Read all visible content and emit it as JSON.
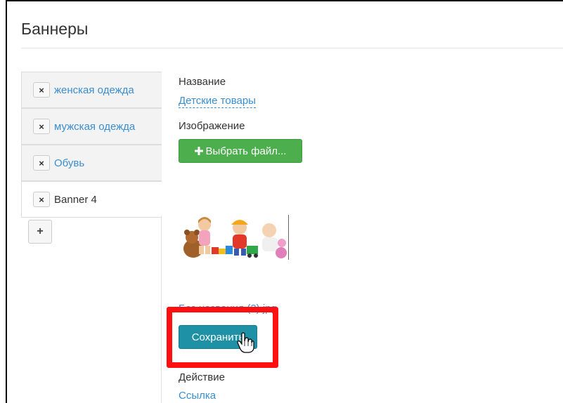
{
  "page": {
    "title": "Баннеры"
  },
  "sidebar": {
    "items": [
      {
        "label": "женская одежда",
        "remove": "×",
        "active": false
      },
      {
        "label": "мужская одежда",
        "remove": "×",
        "active": false
      },
      {
        "label": "Обувь",
        "remove": "×",
        "active": false
      },
      {
        "label": "Banner 4",
        "remove": "×",
        "active": true
      }
    ],
    "add_label": "+"
  },
  "form": {
    "name_label": "Название",
    "name_value": "Детские товары",
    "image_label": "Изображение",
    "choose_file_icon": "plus-icon",
    "choose_file_label": "Выбрать файл...",
    "file_name": "Без названия (2).jpg",
    "save_label": "Сохранить",
    "action_label": "Действие",
    "action_value": "Ссылка"
  },
  "colors": {
    "link": "#3a8ed0",
    "choose_button": "#4cae4c",
    "save_button": "#1f91a6",
    "highlight": "#ff1010"
  }
}
